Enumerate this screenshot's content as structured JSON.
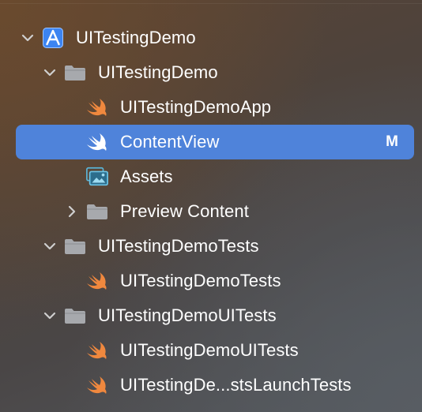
{
  "navigator": {
    "project": {
      "label": "UITestingDemo",
      "expanded": true,
      "icon": "xcode-project-icon"
    },
    "items": [
      {
        "label": "UITestingDemo",
        "kind": "group",
        "expanded": true,
        "icon": "folder-icon"
      },
      {
        "label": "UITestingDemoApp",
        "kind": "swift-file",
        "icon": "swift-icon"
      },
      {
        "label": "ContentView",
        "kind": "swift-file",
        "icon": "swift-icon",
        "selected": true,
        "badge": "M"
      },
      {
        "label": "Assets",
        "kind": "asset-catalog",
        "icon": "assets-icon"
      },
      {
        "label": "Preview Content",
        "kind": "group",
        "expanded": false,
        "icon": "folder-icon"
      },
      {
        "label": "UITestingDemoTests",
        "kind": "group",
        "expanded": true,
        "icon": "folder-icon"
      },
      {
        "label": "UITestingDemoTests",
        "kind": "swift-file",
        "icon": "swift-icon"
      },
      {
        "label": "UITestingDemoUITests",
        "kind": "group",
        "expanded": true,
        "icon": "folder-icon"
      },
      {
        "label": "UITestingDemoUITests",
        "kind": "swift-file",
        "icon": "swift-icon"
      },
      {
        "label": "UITestingDe...stsLaunchTests",
        "kind": "swift-file",
        "icon": "swift-icon"
      }
    ]
  },
  "colors": {
    "selection": "#4f83da",
    "swift": "#f0883e",
    "folder": "#a7a9ad",
    "project": "#3c84f2"
  }
}
